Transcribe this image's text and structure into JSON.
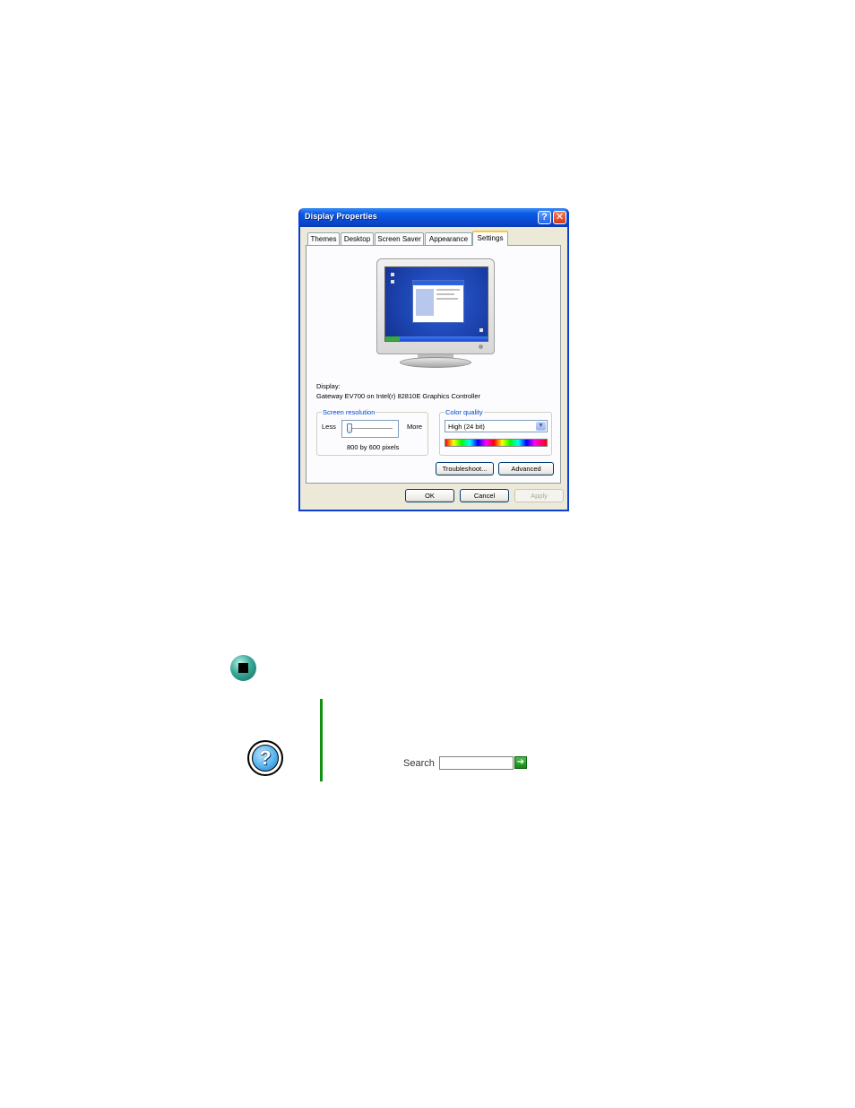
{
  "window": {
    "title": "Display Properties",
    "help_glyph": "?",
    "close_glyph": "✕"
  },
  "tabs": [
    {
      "label": "Themes"
    },
    {
      "label": "Desktop"
    },
    {
      "label": "Screen Saver"
    },
    {
      "label": "Appearance"
    },
    {
      "label": "Settings",
      "active": true
    }
  ],
  "settings": {
    "display_label": "Display:",
    "display_value": "Gateway EV700 on Intel(r) 82810E Graphics Controller",
    "resolution": {
      "group_title": "Screen resolution",
      "less_label": "Less",
      "more_label": "More",
      "value_text": "800 by 600 pixels",
      "slider_position": 0
    },
    "color_quality": {
      "group_title": "Color quality",
      "selected": "High (24 bit)"
    },
    "troubleshoot_label": "Troubleshoot...",
    "advanced_label": "Advanced"
  },
  "footer": {
    "ok_label": "OK",
    "cancel_label": "Cancel",
    "apply_label": "Apply"
  },
  "help": {
    "icon_glyph": "?",
    "search_label": "Search",
    "search_value": "",
    "go_glyph": "➔"
  },
  "colors": {
    "titlebar": "#0a5ae8",
    "tab_highlight": "#ffc83c",
    "help_rule": "#109010",
    "bullet": "#3aa898"
  },
  "icons": [
    "help-icon",
    "close-icon",
    "monitor-icon",
    "stop-bullet-icon",
    "help-circle-icon",
    "arrow-right-icon"
  ]
}
